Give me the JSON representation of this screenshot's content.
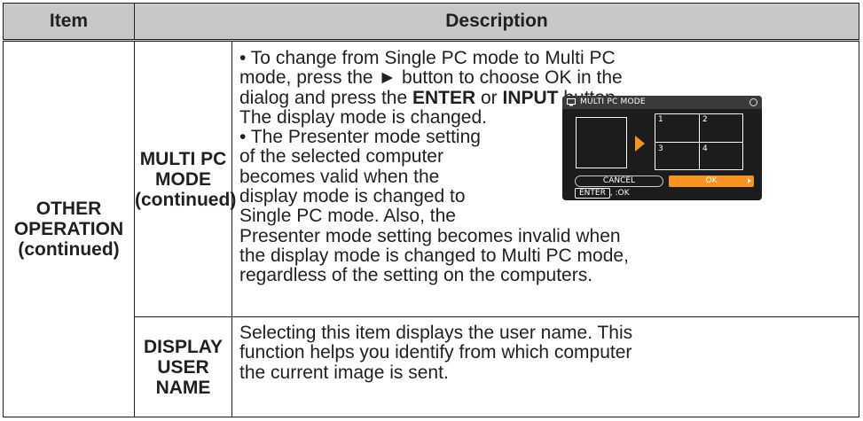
{
  "header": {
    "item": "Item",
    "description": "Description"
  },
  "row": {
    "item_label": [
      "OTHER",
      "OPERATION",
      "(continued)"
    ],
    "multi_pc": {
      "label": [
        "MULTI PC",
        "MODE",
        "(continued)"
      ],
      "intro_line_1": "• To change from Single PC mode to Multi PC",
      "intro_line_2": "mode, press the ► button to choose OK in the",
      "intro_line_3_pre": "dialog and press the ",
      "intro_line_3_b1": "ENTER",
      "intro_line_3_mid": " or ",
      "intro_line_3_b2": "INPUT",
      "intro_line_3_post": " button.",
      "intro_line_4": "The display mode is changed.",
      "presenter_lines": [
        "• The Presenter mode setting",
        "of the selected computer",
        "becomes valid when the",
        "display mode is changed to",
        "Single PC mode. Also, the"
      ],
      "tail_lines": [
        "Presenter mode setting becomes invalid when",
        "the display mode is changed to Multi PC mode,",
        "regardless of the setting on the computers."
      ]
    },
    "display_user": {
      "label": [
        "DISPLAY",
        "USER",
        "NAME"
      ],
      "lines": [
        "Selecting this item displays the user name. This",
        "function helps you identify from which computer",
        "the current image is sent."
      ]
    }
  },
  "dialog": {
    "title": "MULTI PC MODE",
    "quadrants": [
      "1",
      "2",
      "3",
      "4"
    ],
    "cancel_label": "CANCEL",
    "ok_label": "OK",
    "hint_key": "ENTER",
    "hint_text": ",  :OK",
    "accent_color": "#f7931e"
  }
}
